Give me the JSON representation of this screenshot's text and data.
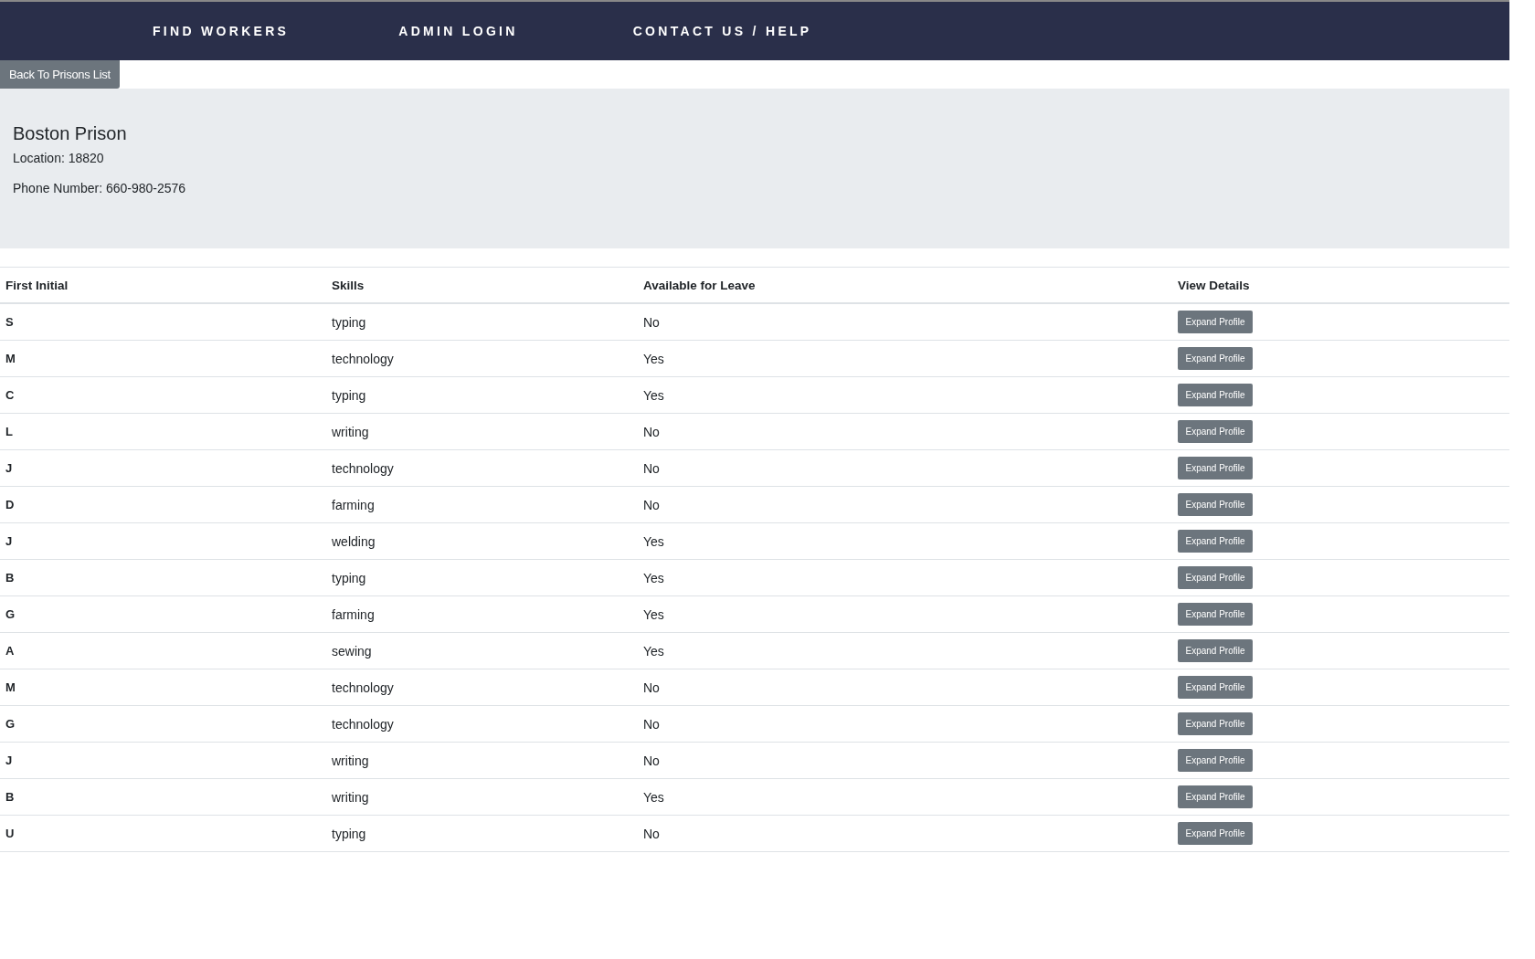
{
  "nav": {
    "links": [
      "FIND WORKERS",
      "ADMIN LOGIN",
      "CONTACT US / HELP"
    ]
  },
  "back_button": "Back To Prisons List",
  "prison": {
    "name": "Boston Prison",
    "location": "Location: 18820",
    "phone": "Phone Number: 660-980-2576"
  },
  "table": {
    "columns": [
      "First Initial",
      "Skills",
      "Available for Leave",
      "View Details"
    ],
    "rows": [
      {
        "initial": "S",
        "skill": "typing",
        "available": "No",
        "action": "Expand Profile"
      },
      {
        "initial": "M",
        "skill": "technology",
        "available": "Yes",
        "action": "Expand Profile"
      },
      {
        "initial": "C",
        "skill": "typing",
        "available": "Yes",
        "action": "Expand Profile"
      },
      {
        "initial": "L",
        "skill": "writing",
        "available": "No",
        "action": "Expand Profile"
      },
      {
        "initial": "J",
        "skill": "technology",
        "available": "No",
        "action": "Expand Profile"
      },
      {
        "initial": "D",
        "skill": "farming",
        "available": "No",
        "action": "Expand Profile"
      },
      {
        "initial": "J",
        "skill": "welding",
        "available": "Yes",
        "action": "Expand Profile"
      },
      {
        "initial": "B",
        "skill": "typing",
        "available": "Yes",
        "action": "Expand Profile"
      },
      {
        "initial": "G",
        "skill": "farming",
        "available": "Yes",
        "action": "Expand Profile"
      },
      {
        "initial": "A",
        "skill": "sewing",
        "available": "Yes",
        "action": "Expand Profile"
      },
      {
        "initial": "M",
        "skill": "technology",
        "available": "No",
        "action": "Expand Profile"
      },
      {
        "initial": "G",
        "skill": "technology",
        "available": "No",
        "action": "Expand Profile"
      },
      {
        "initial": "J",
        "skill": "writing",
        "available": "No",
        "action": "Expand Profile"
      },
      {
        "initial": "B",
        "skill": "writing",
        "available": "Yes",
        "action": "Expand Profile"
      },
      {
        "initial": "U",
        "skill": "typing",
        "available": "No",
        "action": "Expand Profile"
      }
    ]
  }
}
